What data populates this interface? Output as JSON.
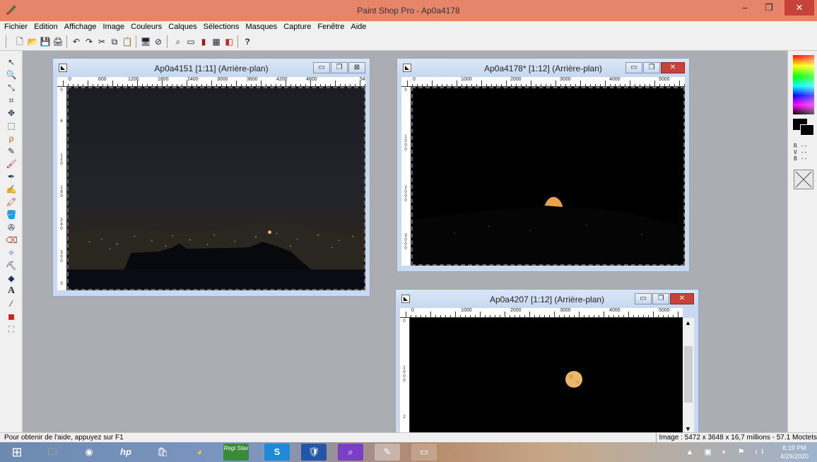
{
  "app": {
    "title": "Paint Shop Pro - Ap0a4178",
    "icon": "paintshop-app-icon",
    "window_controls": [
      "–",
      "❐",
      "✕"
    ]
  },
  "menu": [
    "Fichier",
    "Edition",
    "Affichage",
    "Image",
    "Couleurs",
    "Calques",
    "Sélections",
    "Masques",
    "Capture",
    "Fenêtre",
    "Aide"
  ],
  "toolbar": {
    "icons": [
      "new-icon",
      "open-icon",
      "save-icon",
      "print-icon",
      "undo-icon",
      "redo-icon",
      "cut-icon",
      "copy-icon",
      "paste-icon",
      "monitor-icon",
      "no-icon",
      "dropper-icon",
      "screen-icon",
      "histogram-icon",
      "image-icon",
      "layers-icon",
      "help-icon"
    ],
    "glyphs": [
      "🗋",
      "📂",
      "💾",
      "🖨",
      "↶",
      "↷",
      "✂",
      "⧉",
      "📋",
      "🖥",
      "⊘",
      "⌕",
      "▭",
      "▮",
      "▦",
      "◧",
      "?"
    ]
  },
  "tools": {
    "icons": [
      "arrow-icon",
      "zoom-icon",
      "deformation-icon",
      "crop-icon",
      "move-icon",
      "selection-icon",
      "lasso-icon",
      "eyedropper-icon",
      "brush-icon",
      "clone-icon",
      "retouch-icon",
      "recolor-icon",
      "flood-fill-icon",
      "scratch-remover-icon",
      "eraser-icon",
      "spray-icon",
      "picture-tube-icon",
      "shape-icon",
      "text-icon",
      "line-icon",
      "object-icon",
      "preset-shape-icon"
    ],
    "glyphs": [
      "↖",
      "🔍",
      "⤡",
      "⌗",
      "✥",
      "⬚",
      "ρ",
      "✎",
      "🖌",
      "✒",
      "✍",
      "🖍",
      "🪣",
      "✇",
      "⌫",
      "✧",
      "⛏",
      "◆",
      "A",
      "⁄",
      "◼",
      "⛶"
    ]
  },
  "right_panel": {
    "rgb": [
      "R --",
      "V --",
      "B --"
    ]
  },
  "documents": [
    {
      "title": "Ap0a4151 [1:11] (Arrière-plan)",
      "ruler_h": [
        "0",
        "600",
        "1200",
        "1800",
        "2400",
        "3000",
        "3600",
        "4200",
        "4800",
        "54"
      ],
      "ruler_v": [
        "0",
        "6",
        "1 2 0",
        "1 8 0",
        "2 4 0",
        "3 0 0",
        "3"
      ],
      "scene": "city-night",
      "has_close_red": false
    },
    {
      "title": "Ap0a4178* [1:12] (Arrière-plan)",
      "ruler_h": [
        "0",
        "1000",
        "2000",
        "3000",
        "4000",
        "5000"
      ],
      "ruler_v": [
        "0",
        "1 0 0 0",
        "2 0 0 0",
        "3 0 0 0"
      ],
      "scene": "moon-rising",
      "has_close_red": true
    },
    {
      "title": "Ap0a4207 [1:12] (Arrière-plan)",
      "ruler_h": [
        "0",
        "1000",
        "2000",
        "3000",
        "4000",
        "5000"
      ],
      "ruler_v": [
        "0",
        "1 0 0 0",
        "2"
      ],
      "scene": "full-moon",
      "has_close_red": true
    }
  ],
  "status": {
    "help": "Pour obtenir de l'aide, appuyez sur F1",
    "image_info": "Image : 5472 x 3648 x 16,7 millions - 57.1 Moctets"
  },
  "taskbar": {
    "apps": [
      "start-icon",
      "file-explorer-icon",
      "webcam-icon",
      "hp-icon",
      "store-icon",
      "chrome-icon",
      "registax-icon",
      "skype-icon",
      "security-icon",
      "search-app-icon",
      "paintshop-task-icon",
      "monitor-task-icon"
    ],
    "glyphs": [
      "⊞",
      "🗀",
      "◉",
      "hp",
      "🛍",
      "◕",
      "Regi Stax",
      "S",
      "🛡",
      "⌕",
      "✎",
      "▭"
    ],
    "time": "6:19 PM",
    "date": "4/29/2020"
  },
  "colors": {
    "titlebar": "#e7856b",
    "close": "#c7423a",
    "workspace": "#abadb3"
  }
}
